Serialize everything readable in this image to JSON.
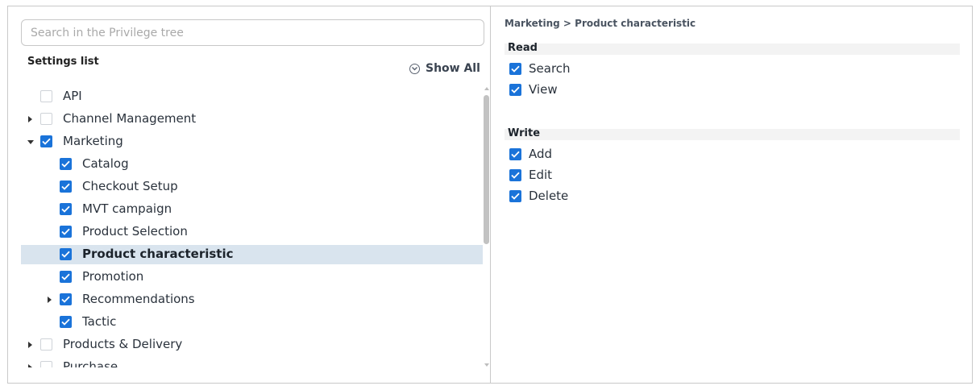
{
  "search": {
    "placeholder": "Search in the Privilege tree",
    "value": ""
  },
  "settings_list": {
    "title": "Settings list",
    "show_all_label": "Show All"
  },
  "tree": [
    {
      "label": "API",
      "checked": false,
      "expander": "none",
      "depth": 0,
      "selected": false
    },
    {
      "label": "Channel Management",
      "checked": false,
      "expander": "collapsed",
      "depth": 0,
      "selected": false
    },
    {
      "label": "Marketing",
      "checked": true,
      "expander": "expanded",
      "depth": 0,
      "selected": false
    },
    {
      "label": "Catalog",
      "checked": true,
      "expander": "none",
      "depth": 1,
      "selected": false
    },
    {
      "label": "Checkout Setup",
      "checked": true,
      "expander": "none",
      "depth": 1,
      "selected": false
    },
    {
      "label": "MVT campaign",
      "checked": true,
      "expander": "none",
      "depth": 1,
      "selected": false
    },
    {
      "label": "Product Selection",
      "checked": true,
      "expander": "none",
      "depth": 1,
      "selected": false
    },
    {
      "label": "Product characteristic",
      "checked": true,
      "expander": "none",
      "depth": 1,
      "selected": true
    },
    {
      "label": "Promotion",
      "checked": true,
      "expander": "none",
      "depth": 1,
      "selected": false
    },
    {
      "label": "Recommendations",
      "checked": true,
      "expander": "collapsed",
      "depth": 1,
      "selected": false
    },
    {
      "label": "Tactic",
      "checked": true,
      "expander": "none",
      "depth": 1,
      "selected": false
    },
    {
      "label": "Products & Delivery",
      "checked": false,
      "expander": "collapsed",
      "depth": 0,
      "selected": false
    },
    {
      "label": "Purchase",
      "checked": false,
      "expander": "collapsed",
      "depth": 0,
      "selected": false
    }
  ],
  "detail": {
    "breadcrumb": "Marketing > Product characteristic",
    "sections": [
      {
        "title": "Read",
        "items": [
          {
            "label": "Search",
            "checked": true
          },
          {
            "label": "View",
            "checked": true
          }
        ]
      },
      {
        "title": "Write",
        "items": [
          {
            "label": "Add",
            "checked": true
          },
          {
            "label": "Edit",
            "checked": true
          },
          {
            "label": "Delete",
            "checked": true
          }
        ]
      }
    ]
  },
  "colors": {
    "accent": "#1a73d9",
    "selected_row": "#d9e4ee",
    "border": "#c9c9c9"
  }
}
